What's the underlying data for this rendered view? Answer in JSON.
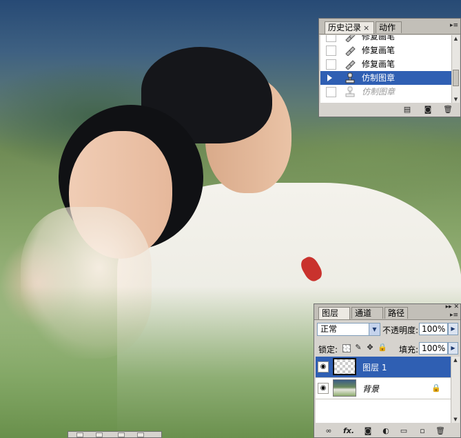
{
  "history_panel": {
    "tabs": [
      {
        "label": "历史记录",
        "close": "×",
        "active": true
      },
      {
        "label": "动作",
        "active": false
      }
    ],
    "menu_icon": "panel-menu-icon",
    "items": [
      {
        "label": "修复画笔",
        "icon": "healing-brush-icon",
        "state": "normal"
      },
      {
        "label": "修复画笔",
        "icon": "healing-brush-icon",
        "state": "normal"
      },
      {
        "label": "修复画笔",
        "icon": "healing-brush-icon",
        "state": "normal"
      },
      {
        "label": "仿制图章",
        "icon": "clone-stamp-icon",
        "state": "selected"
      },
      {
        "label": "仿制图章",
        "icon": "clone-stamp-icon",
        "state": "dimmed"
      }
    ],
    "footer_icons": [
      "new-document-from-state-icon",
      "snapshot-camera-icon",
      "trash-icon"
    ]
  },
  "layers_panel": {
    "tabs": [
      {
        "label": "图层",
        "close": "×",
        "active": true
      },
      {
        "label": "通道",
        "close": "×",
        "active": false
      },
      {
        "label": "路径",
        "active": false
      }
    ],
    "blend_mode": "正常",
    "opacity_label": "不透明度:",
    "opacity_value": "100%",
    "lock_label": "锁定:",
    "lock_icons": [
      "lock-transparent-icon",
      "lock-paint-icon",
      "lock-move-icon",
      "lock-all-icon"
    ],
    "fill_label": "填充:",
    "fill_value": "100%",
    "layers": [
      {
        "name": "图层 1",
        "visible": true,
        "selected": true,
        "locked": false
      },
      {
        "name": "背景",
        "visible": true,
        "selected": false,
        "locked": true
      }
    ],
    "footer_icons": [
      "link-layers-icon",
      "fx-icon",
      "layer-mask-icon",
      "adjustment-layer-icon",
      "group-folder-icon",
      "new-layer-icon",
      "trash-icon"
    ],
    "footer_fx_label": "fx."
  },
  "colors": {
    "selection": "#2f5fb3",
    "panel_bg": "#d6d3ce"
  }
}
